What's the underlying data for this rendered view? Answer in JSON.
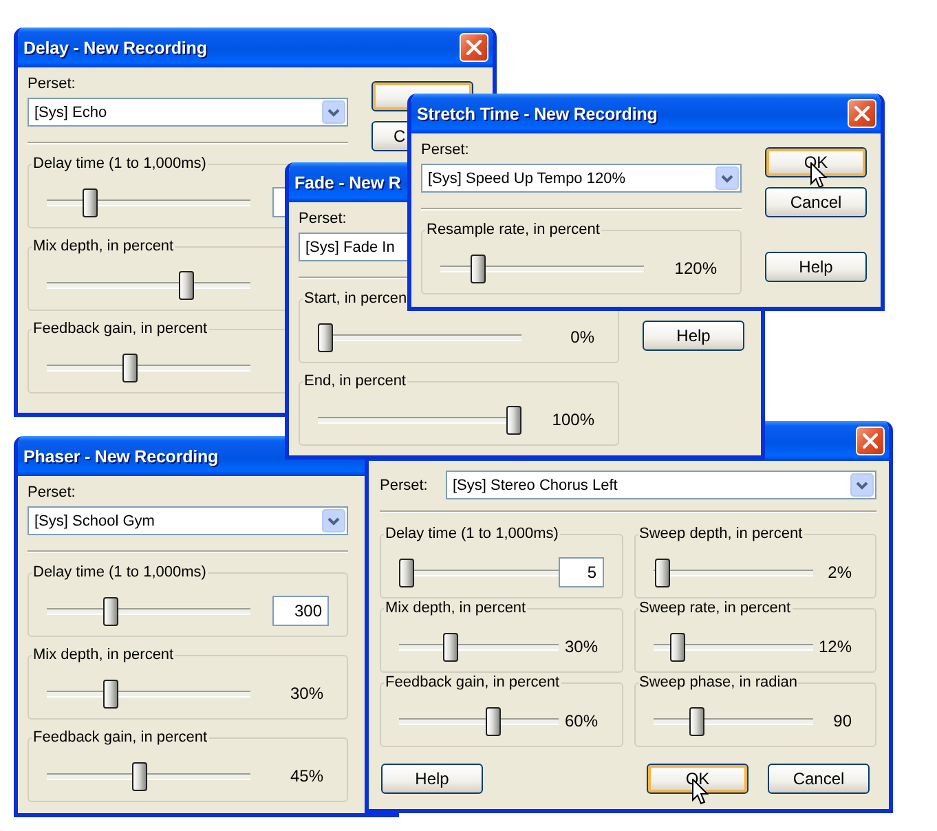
{
  "windows": [
    {
      "kind": "single",
      "title": "Delay - New Recording",
      "close": true,
      "preset_label": "Perset:",
      "preset": "[Sys] Echo",
      "groups": [
        {
          "kind": "field",
          "label": "Delay time (1 to 1,000ms)",
          "level": 0.19
        },
        {
          "kind": "slider",
          "label": "Mix depth, in percent",
          "level": 0.7
        },
        {
          "kind": "slider",
          "label": "Feedback gain, in percent",
          "level": 0.4
        }
      ],
      "buttons": [
        {
          "kind": "ok",
          "default": true,
          "clipped": false
        },
        {
          "kind": "cancel",
          "label": "C",
          "default": false,
          "clipped": true
        }
      ]
    },
    {
      "kind": "single",
      "title": "Stretch Time - New Recording",
      "close": true,
      "preset_label": "Perset:",
      "preset": "[Sys] Speed Up Tempo 120%",
      "groups": [
        {
          "kind": "reading",
          "label": "Resample rate, in percent",
          "level": 0.16,
          "reading": "120%"
        }
      ],
      "buttons": [
        {
          "kind": "ok",
          "label": "OK",
          "default": true,
          "pointer": true,
          "clipped": false
        },
        {
          "kind": "cancel",
          "label": "Cancel",
          "default": false,
          "pointer": false,
          "clipped": false
        },
        {
          "kind": "help",
          "label": "Help",
          "default": false,
          "pointer": false,
          "clipped": false
        }
      ]
    },
    {
      "kind": "single",
      "title": "Fade - New R",
      "preset_label": "Perset:",
      "preset": "[Sys] Fade In",
      "groups": [
        {
          "kind": "reading",
          "label": "Start, in percen",
          "level": 0,
          "reading": "0%"
        },
        {
          "kind": "reading",
          "label": "End, in percent",
          "level": 1,
          "reading": "100%"
        }
      ],
      "buttons": [
        {
          "kind": "help",
          "label": "Help",
          "default": false,
          "pointer": false,
          "clipped": false
        }
      ]
    },
    {
      "kind": "single",
      "title": "Phaser - New Recording",
      "close": false,
      "preset_label": "Perset:",
      "preset": "[Sys] School Gym",
      "groups": [
        {
          "kind": "field",
          "label": "Delay time (1 to 1,000ms)",
          "level": 0.3,
          "value": "300"
        },
        {
          "kind": "reading",
          "label": "Mix depth, in percent",
          "level": 0.3,
          "reading": "30%"
        },
        {
          "kind": "reading",
          "label": "Feedback gain, in percent",
          "level": 0.45,
          "reading": "45%"
        }
      ]
    },
    {
      "kind": "grid",
      "close": true,
      "preset_label": "Perset:",
      "preset": "[Sys] Stereo Chorus Left",
      "groups": [
        {
          "kind": "field",
          "label": "Delay time (1 to 1,000ms)",
          "level": 0,
          "value": "5"
        },
        {
          "kind": "reading",
          "label": "Sweep depth, in percent",
          "level": 0.01,
          "reading": "2%"
        },
        {
          "kind": "reading",
          "label": "Mix depth, in percent",
          "level": 0.3,
          "reading": "30%"
        },
        {
          "kind": "reading",
          "label": "Sweep rate, in percent",
          "level": 0.12,
          "reading": "12%"
        },
        {
          "kind": "reading",
          "label": "Feedback gain, in percent",
          "level": 0.6,
          "reading": "60%"
        },
        {
          "kind": "reading",
          "label": "Sweep phase, in radian",
          "level": 0.25,
          "reading": "90"
        }
      ],
      "buttons": [
        {
          "kind": "help",
          "label": "Help",
          "default": false,
          "pointer": false,
          "clipped": false
        },
        {
          "kind": "ok",
          "label": "OK",
          "default": true,
          "pointer": true,
          "clipped": false
        },
        {
          "kind": "cancel",
          "label": "Cancel",
          "default": false,
          "pointer": false,
          "clipped": false
        }
      ]
    }
  ]
}
